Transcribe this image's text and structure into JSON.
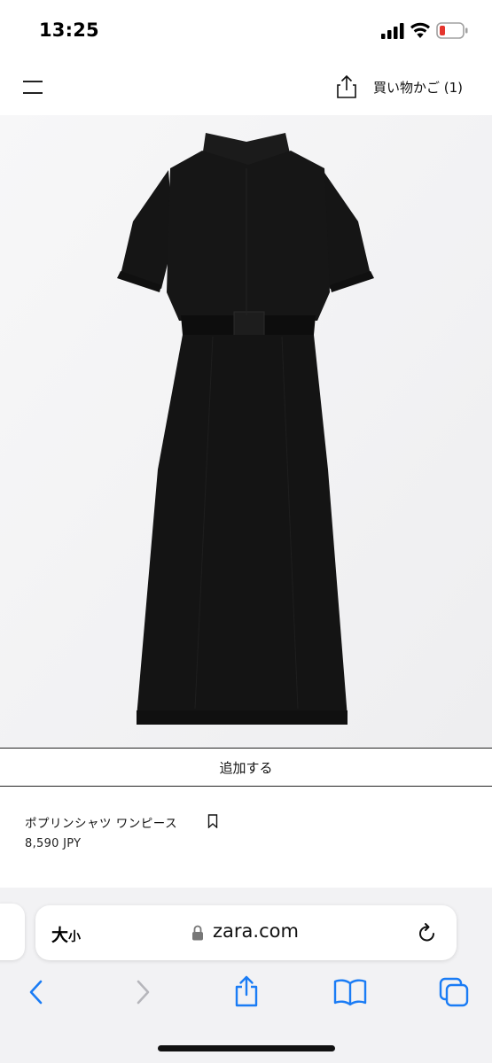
{
  "status_bar": {
    "time": "13:25",
    "battery_color": "#e5352d"
  },
  "header": {
    "menu_icon": "hamburger-menu-icon",
    "share_icon": "share-icon",
    "cart_label": "買い物かご (1)"
  },
  "product": {
    "image_subject": "black shirt dress",
    "add_button_label": "追加する",
    "name": "ポプリンシャツ ワンピース",
    "price": "8,590 JPY",
    "bookmark_icon": "bookmark-icon"
  },
  "browser": {
    "text_size_large": "大",
    "text_size_small": "小",
    "url": "zara.com",
    "accent_color": "#1a7cf5",
    "disabled_color": "#b6b6bb",
    "toolbar": [
      "back-icon",
      "forward-icon",
      "share-icon",
      "bookmarks-icon",
      "tabs-icon"
    ]
  }
}
